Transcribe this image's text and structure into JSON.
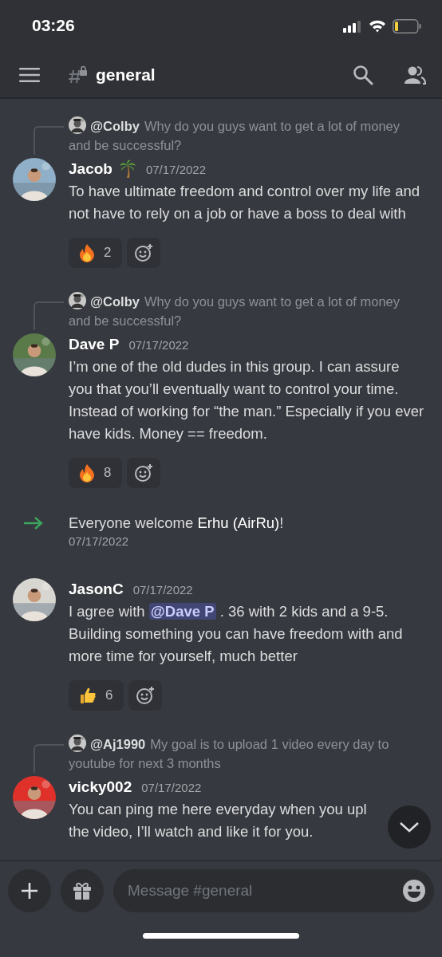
{
  "status_bar": {
    "time": "03:26"
  },
  "header": {
    "channel": "general"
  },
  "messages": [
    {
      "kind": "user",
      "reply": {
        "author": "@Colby",
        "text": "Why do you guys want to get a lot of money and be successful?"
      },
      "author": "Jacob",
      "badges": [
        {
          "kind": "palm_tree"
        }
      ],
      "timestamp": "07/17/2022",
      "parts": [
        {
          "text": "To have ultimate freedom and control over my life and not have to rely on a job or have a boss to deal with"
        }
      ],
      "reactions": [
        {
          "kind": "fire",
          "count": "2"
        }
      ]
    },
    {
      "kind": "user",
      "reply": {
        "author": "@Colby",
        "text": "Why do you guys want to get a lot of money and be successful?"
      },
      "author": "Dave P",
      "timestamp": "07/17/2022",
      "parts": [
        {
          "text": "I’m one of the old dudes in this group. I can assure you that you’ll eventually want to control your time. Instead of working for “the man.” Especially if you ever have kids. Money == freedom."
        }
      ],
      "reactions": [
        {
          "kind": "fire",
          "count": "8"
        }
      ]
    },
    {
      "kind": "join",
      "text": "Everyone welcome **Erhu (AirRu)**!",
      "timestamp": "07/17/2022"
    },
    {
      "kind": "user",
      "author": "JasonC",
      "timestamp": "07/17/2022",
      "parts": [
        {
          "text": "I agree with "
        },
        {
          "text": "@Dave P",
          "kind": "mention"
        },
        {
          "text": " . 36  with 2 kids and a 9-5. Building something you can have freedom with and more time for yourself, much better"
        }
      ],
      "reactions": [
        {
          "kind": "thumbs_up",
          "count": "6"
        }
      ]
    },
    {
      "kind": "user",
      "reply": {
        "author": "@Aj1990",
        "text": "My goal is to upload 1 video every day to youtube for next 3 months"
      },
      "author": "vicky002",
      "timestamp": "07/17/2022",
      "lines": [
        "You can ping me here everyday when you upl",
        "the video, I’ll watch and like it for you."
      ]
    }
  ],
  "composer": {
    "placeholder": "Message #general"
  }
}
